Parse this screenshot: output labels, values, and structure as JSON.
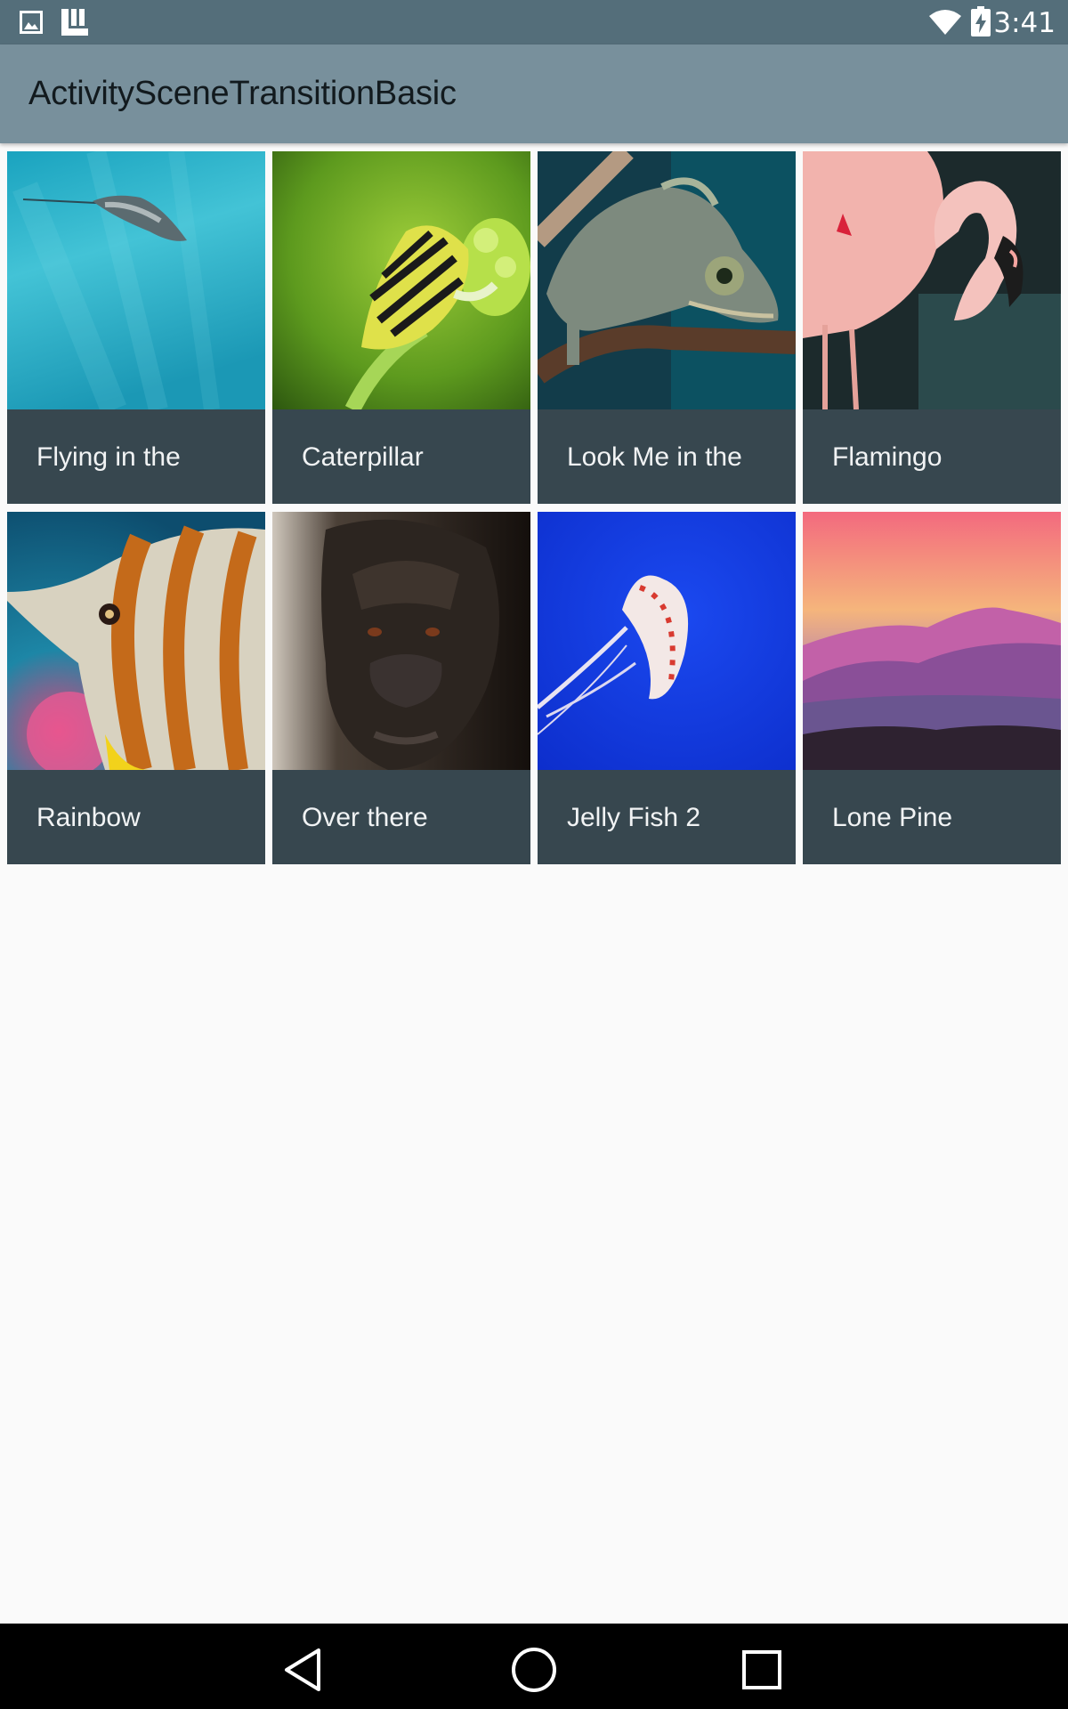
{
  "status_bar": {
    "time": "3:41",
    "left_icons": [
      "image-icon",
      "launcher-icon"
    ],
    "right_icons": [
      "wifi-icon",
      "battery-charging-icon"
    ]
  },
  "app_bar": {
    "title": "ActivitySceneTransitionBasic"
  },
  "grid": {
    "items": [
      {
        "label": "Flying in the",
        "image": "stingray-photo"
      },
      {
        "label": "Caterpillar",
        "image": "caterpillar-photo"
      },
      {
        "label": "Look Me in the",
        "image": "chameleon-photo"
      },
      {
        "label": "Flamingo",
        "image": "flamingo-photo"
      },
      {
        "label": "Rainbow",
        "image": "butterflyfish-photo"
      },
      {
        "label": "Over there",
        "image": "gorilla-photo"
      },
      {
        "label": "Jelly Fish 2",
        "image": "jellyfish-photo"
      },
      {
        "label": "Lone Pine",
        "image": "mountains-photo"
      }
    ]
  },
  "nav_bar": {
    "buttons": [
      "back-icon",
      "home-icon",
      "recents-icon"
    ]
  },
  "colors": {
    "status_bar": "#546e7a",
    "app_bar": "#78909c",
    "tile_caption": "#37474f",
    "background": "#fafafa"
  }
}
